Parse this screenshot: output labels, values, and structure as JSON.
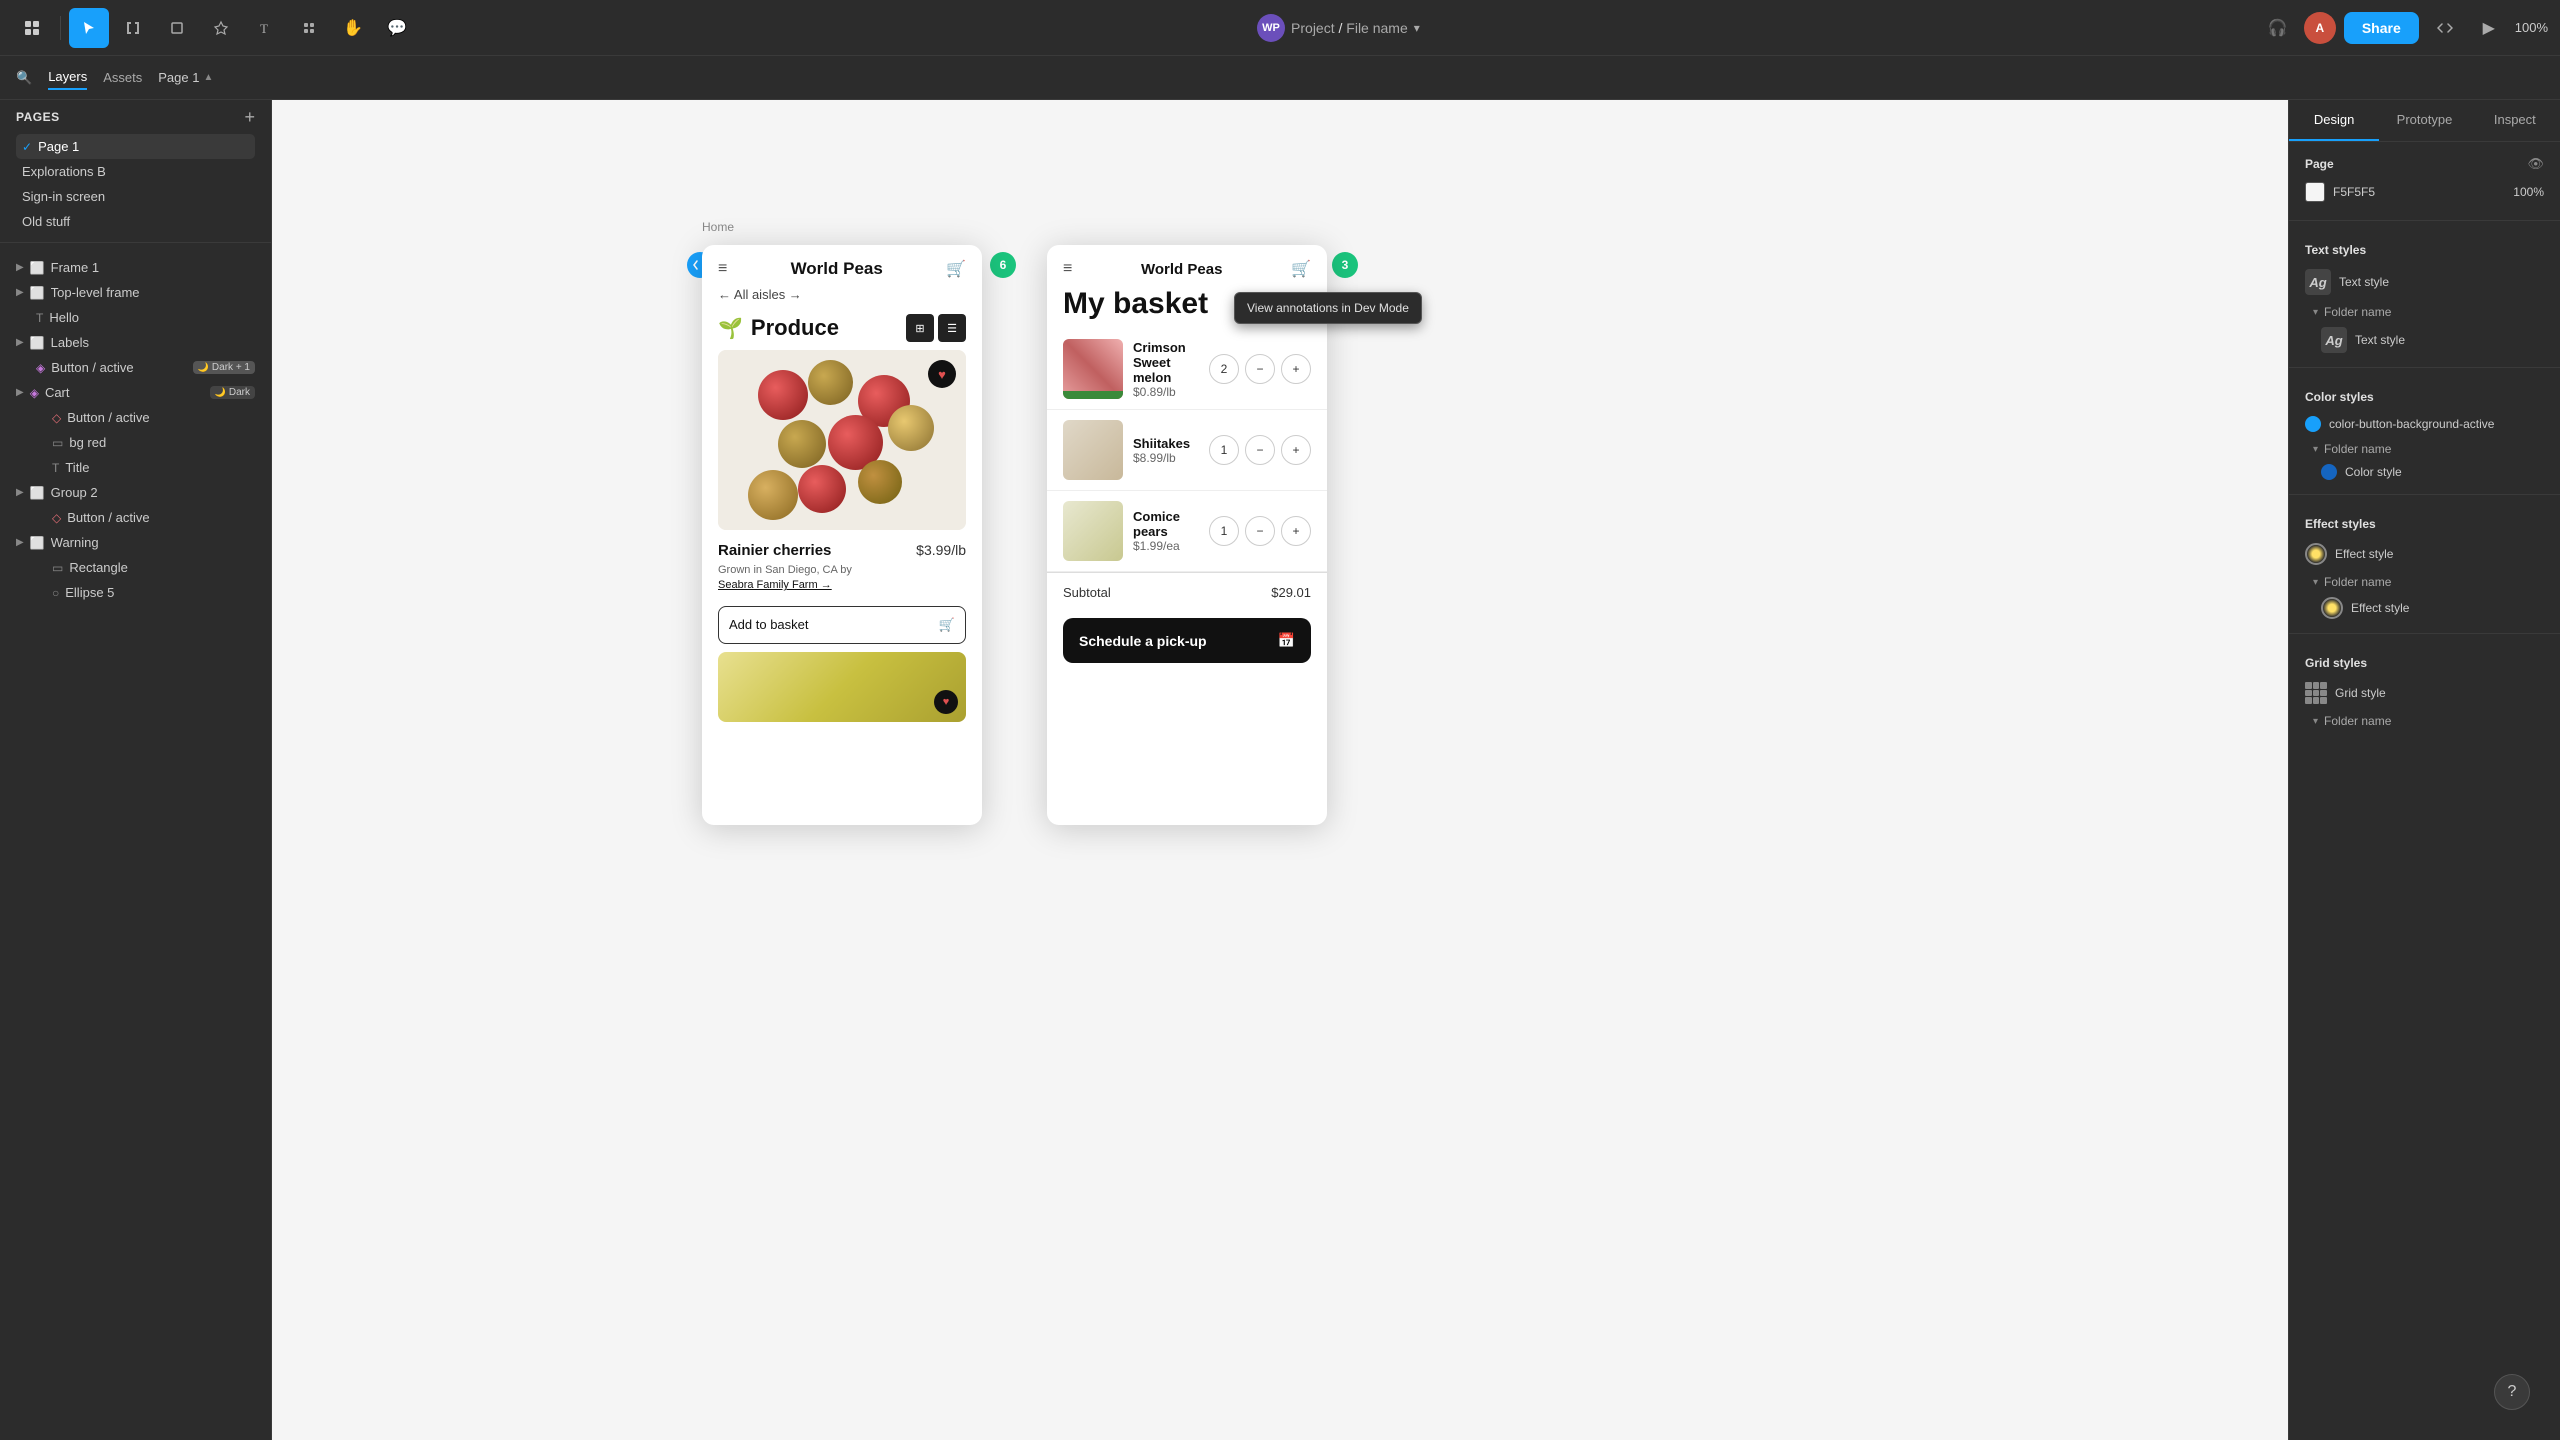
{
  "topbar": {
    "project_name": "Project",
    "file_name": "File name",
    "share_label": "Share",
    "zoom": "100%",
    "avatar_initials": "A"
  },
  "left_panel": {
    "layers_tab": "Layers",
    "assets_tab": "Assets",
    "page_selector_label": "Page 1",
    "pages_section_title": "Pages",
    "pages": [
      {
        "label": "Page 1",
        "active": true
      },
      {
        "label": "Explorations B",
        "active": false
      },
      {
        "label": "Sign-in screen",
        "active": false
      },
      {
        "label": "Old stuff",
        "active": false
      }
    ],
    "layers": [
      {
        "label": "Frame 1",
        "icon": "frame",
        "indent": 0,
        "type": "frame"
      },
      {
        "label": "Top-level frame",
        "icon": "frame",
        "indent": 0,
        "type": "frame"
      },
      {
        "label": "Hello",
        "icon": "text",
        "indent": 0,
        "type": "text"
      },
      {
        "label": "Labels",
        "icon": "frame",
        "indent": 0,
        "type": "frame"
      },
      {
        "label": "Button / active",
        "icon": "component",
        "indent": 0,
        "type": "component",
        "badge": "Dark + 1"
      },
      {
        "label": "Cart",
        "icon": "component",
        "indent": 0,
        "type": "component",
        "badge": "Dark"
      },
      {
        "label": "Button / active",
        "icon": "diamond",
        "indent": 1,
        "type": "diamond"
      },
      {
        "label": "bg red",
        "icon": "rect",
        "indent": 1,
        "type": "rect"
      },
      {
        "label": "Title",
        "icon": "text",
        "indent": 1,
        "type": "text"
      },
      {
        "label": "Group 2",
        "icon": "frame",
        "indent": 0,
        "type": "frame"
      },
      {
        "label": "Button / active",
        "icon": "diamond",
        "indent": 1,
        "type": "diamond"
      },
      {
        "label": "Warning",
        "icon": "frame",
        "indent": 0,
        "type": "frame"
      },
      {
        "label": "Rectangle",
        "icon": "rect",
        "indent": 1,
        "type": "rect"
      },
      {
        "label": "Ellipse 5",
        "icon": "ellipse",
        "indent": 1,
        "type": "ellipse"
      }
    ]
  },
  "canvas": {
    "home_label": "Home",
    "annotation_number_1": "6",
    "annotation_number_2": "6",
    "annotation_number_3": "3",
    "phone1": {
      "title": "World Peas",
      "breadcrumb": "← All aisles →",
      "section_title": "Produce",
      "product_name": "Rainier cherries",
      "product_price": "$3.99/lb",
      "product_origin": "Grown in San Diego, CA by",
      "product_farm": "Seabra Family Farm →",
      "add_basket_btn": "Add to basket"
    },
    "phone2": {
      "title": "World Peas",
      "basket_title": "My basket",
      "items": [
        {
          "name": "Crimson Sweet melon",
          "price": "$0.89/lb",
          "qty": "2"
        },
        {
          "name": "Shiitakes",
          "price": "$8.99/lb",
          "qty": "1"
        },
        {
          "name": "Comice pears",
          "price": "$1.99/ea",
          "qty": "1"
        }
      ],
      "subtotal_label": "Subtotal",
      "subtotal_value": "$29.01",
      "schedule_btn": "Schedule a pick-up"
    },
    "tooltip": "View annotations in Dev Mode"
  },
  "right_panel": {
    "design_tab": "Design",
    "prototype_tab": "Prototype",
    "inspect_tab": "Inspect",
    "page_section_title": "Page",
    "page_color_value": "F5F5F5",
    "page_opacity": "100%",
    "text_styles_title": "Text styles",
    "text_styles": [
      {
        "label": "Text style"
      },
      {
        "folder_label": "Folder name"
      },
      {
        "label": "Text style"
      }
    ],
    "color_styles_title": "Color styles",
    "color_styles": [
      {
        "label": "color-button-background-active",
        "color": "blue"
      },
      {
        "folder_label": "Folder name"
      },
      {
        "label": "Color style",
        "color": "blue-dark"
      }
    ],
    "effect_styles_title": "Effect styles",
    "effect_styles": [
      {
        "label": "Effect style"
      },
      {
        "folder_label": "Folder name"
      },
      {
        "label": "Effect style"
      }
    ],
    "grid_styles_title": "Grid styles",
    "grid_styles": [
      {
        "label": "Grid style"
      },
      {
        "folder_label": "Folder name"
      }
    ]
  }
}
